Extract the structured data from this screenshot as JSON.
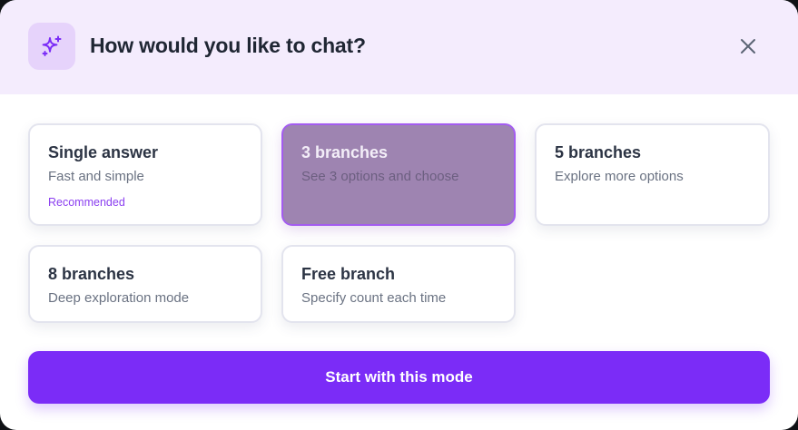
{
  "dialog": {
    "title": "How would you like to chat?",
    "header_icon": "sparkles-icon",
    "close_icon": "close-icon"
  },
  "options": [
    {
      "title": "Single answer",
      "subtitle": "Fast and simple",
      "badge": "Recommended",
      "selected": false
    },
    {
      "title": "3 branches",
      "subtitle": "See 3 options and choose",
      "selected": true
    },
    {
      "title": "5 branches",
      "subtitle": "Explore more options",
      "selected": false
    },
    {
      "title": "8 branches",
      "subtitle": "Deep exploration mode",
      "selected": false
    },
    {
      "title": "Free branch",
      "subtitle": "Specify count each time",
      "selected": false
    }
  ],
  "actions": {
    "start_label": "Start with this mode"
  },
  "colors": {
    "accent": "#7b2cf7",
    "header_bg": "#f4ecfd",
    "selected_card_bg": "#9e84b1",
    "selected_card_border": "#a35cf0"
  }
}
